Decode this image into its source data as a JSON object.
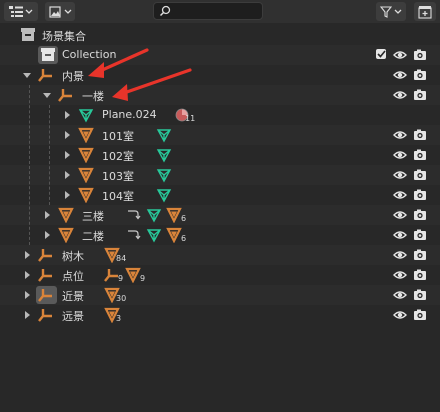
{
  "toolbar": {
    "display_mode_icon": "outliner-view-icon",
    "filter_icon": "funnel-icon",
    "search_placeholder": "",
    "new_collection_icon": "new-collection-icon"
  },
  "scene_collection": {
    "label": "场景集合"
  },
  "rows": [
    {
      "label": "Collection",
      "icon": "collection-box-icon"
    },
    {
      "label": "内景",
      "icon": "empty-icon"
    },
    {
      "label": "一楼",
      "icon": "empty-icon"
    },
    {
      "label": "Plane.024",
      "icon": "mesh-data-icon",
      "material_count": "11"
    },
    {
      "label": "101室",
      "icon": "object-triangle-icon"
    },
    {
      "label": "102室",
      "icon": "object-triangle-icon"
    },
    {
      "label": "103室",
      "icon": "object-triangle-icon"
    },
    {
      "label": "104室",
      "icon": "object-triangle-icon"
    },
    {
      "label": "三楼",
      "icon": "object-triangle-icon",
      "child_count": "6"
    },
    {
      "label": "二楼",
      "icon": "object-triangle-icon",
      "child_count": "6"
    },
    {
      "label": "树木",
      "icon": "empty-icon",
      "child_count": "84"
    },
    {
      "label": "点位",
      "icon": "empty-icon",
      "empty_count": "9",
      "child_count": "9"
    },
    {
      "label": "近景",
      "icon": "empty-icon",
      "child_count": "30"
    },
    {
      "label": "远景",
      "icon": "empty-icon",
      "child_count": "3"
    }
  ],
  "colors": {
    "background": "#282828",
    "empty_orange": "#d9843a",
    "mesh_green": "#28c89a",
    "annotation_red": "#e8342a"
  }
}
